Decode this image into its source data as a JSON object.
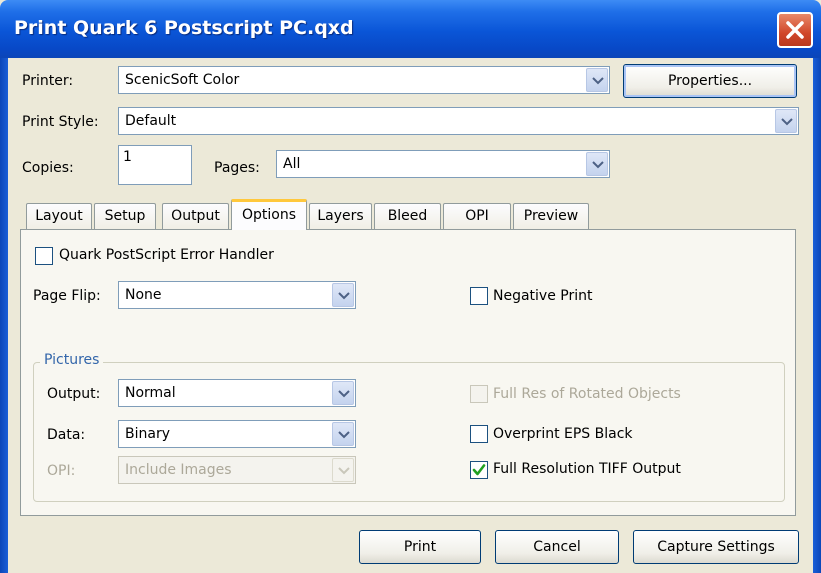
{
  "window": {
    "title": "Print Quark 6 Postscript PC.qxd"
  },
  "printer": {
    "label": "Printer:",
    "value": "ScenicSoft Color",
    "properties_button": "Properties..."
  },
  "print_style": {
    "label": "Print Style:",
    "value": "Default"
  },
  "copies": {
    "label": "Copies:",
    "value": "1"
  },
  "pages": {
    "label": "Pages:",
    "value": "All"
  },
  "tabs": [
    {
      "label": "Layout"
    },
    {
      "label": "Setup"
    },
    {
      "label": "Output"
    },
    {
      "label": "Options",
      "active": true
    },
    {
      "label": "Layers"
    },
    {
      "label": "Bleed"
    },
    {
      "label": "OPI"
    },
    {
      "label": "Preview"
    }
  ],
  "options": {
    "error_handler": {
      "label": "Quark PostScript Error Handler",
      "checked": false
    },
    "page_flip": {
      "label": "Page Flip:",
      "value": "None"
    },
    "negative_print": {
      "label": "Negative Print",
      "checked": false
    },
    "pictures": {
      "title": "Pictures",
      "output": {
        "label": "Output:",
        "value": "Normal"
      },
      "data": {
        "label": "Data:",
        "value": "Binary"
      },
      "opi": {
        "label": "OPI:",
        "value": "Include Images",
        "disabled": true
      },
      "full_res_rotated": {
        "label": "Full Res of Rotated Objects",
        "checked": false,
        "disabled": true
      },
      "overprint_eps": {
        "label": "Overprint EPS Black",
        "checked": false
      },
      "full_res_tiff": {
        "label": "Full Resolution TIFF Output",
        "checked": true
      }
    }
  },
  "buttons": {
    "print": "Print",
    "cancel": "Cancel",
    "capture": "Capture Settings"
  },
  "colors": {
    "titlebar": "#0a55d7",
    "close": "#d1472a",
    "dialog_bg": "#ece9d8",
    "active_tab_accent": "#ffc83c",
    "check": "#21a121"
  }
}
